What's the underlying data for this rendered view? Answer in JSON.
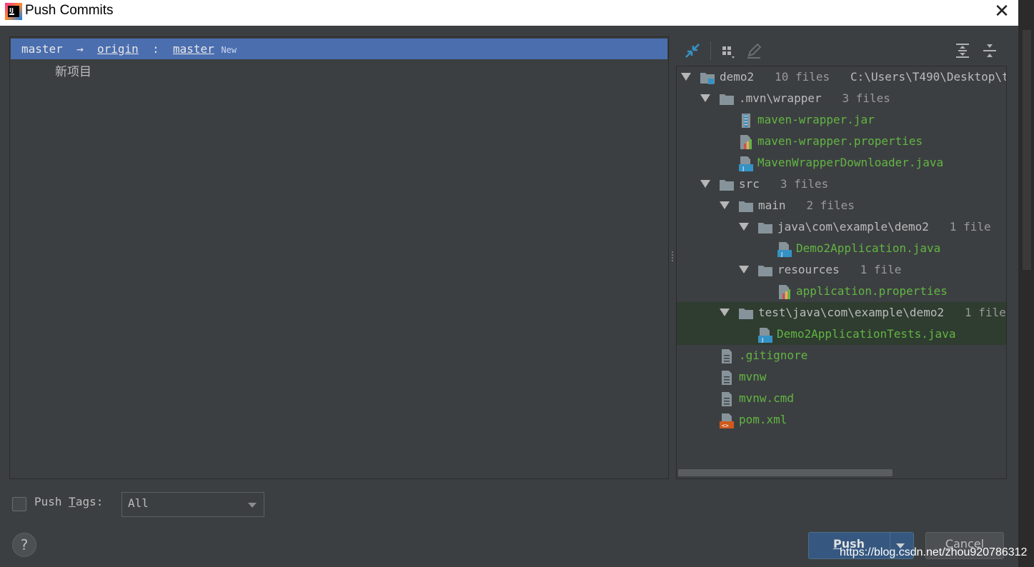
{
  "window": {
    "title": "Push Commits",
    "close_glyph": "✕"
  },
  "branch": {
    "local": "master",
    "arrow": "→",
    "remote": "origin",
    "sep": ":",
    "remote_branch": "master",
    "badge": "New"
  },
  "commit": {
    "message": "新项目"
  },
  "tree": {
    "rows": [
      {
        "name": "demo2",
        "count": "10 files",
        "path": "C:\\Users\\T490\\Desktop\\t"
      },
      {
        "name": ".mvn\\wrapper",
        "count": "3 files"
      },
      {
        "name": "maven-wrapper.jar"
      },
      {
        "name": "maven-wrapper.properties"
      },
      {
        "name": "MavenWrapperDownloader.java"
      },
      {
        "name": "src",
        "count": "3 files"
      },
      {
        "name": "main",
        "count": "2 files"
      },
      {
        "name": "java\\com\\example\\demo2",
        "count": "1 file"
      },
      {
        "name": "Demo2Application.java"
      },
      {
        "name": "resources",
        "count": "1 file"
      },
      {
        "name": "application.properties"
      },
      {
        "name": "test\\java\\com\\example\\demo2",
        "count": "1 file"
      },
      {
        "name": "Demo2ApplicationTests.java"
      },
      {
        "name": ".gitignore"
      },
      {
        "name": "mvnw"
      },
      {
        "name": "mvnw.cmd"
      },
      {
        "name": "pom.xml"
      }
    ]
  },
  "tags": {
    "label_pre": "Push ",
    "label_mnemonic": "T",
    "label_post": "ags:",
    "select_value": "All"
  },
  "buttons": {
    "help": "?",
    "push_mnemonic": "P",
    "push_rest": "ush",
    "cancel_mnemonic": "C",
    "cancel_rest": "ancel"
  },
  "watermark": "https://blog.csdn.net/zhou920786312",
  "colors": {
    "selection": "#4b6eaf",
    "added_file": "#62b543",
    "background": "#3c3f41",
    "push_button": "#365880"
  }
}
